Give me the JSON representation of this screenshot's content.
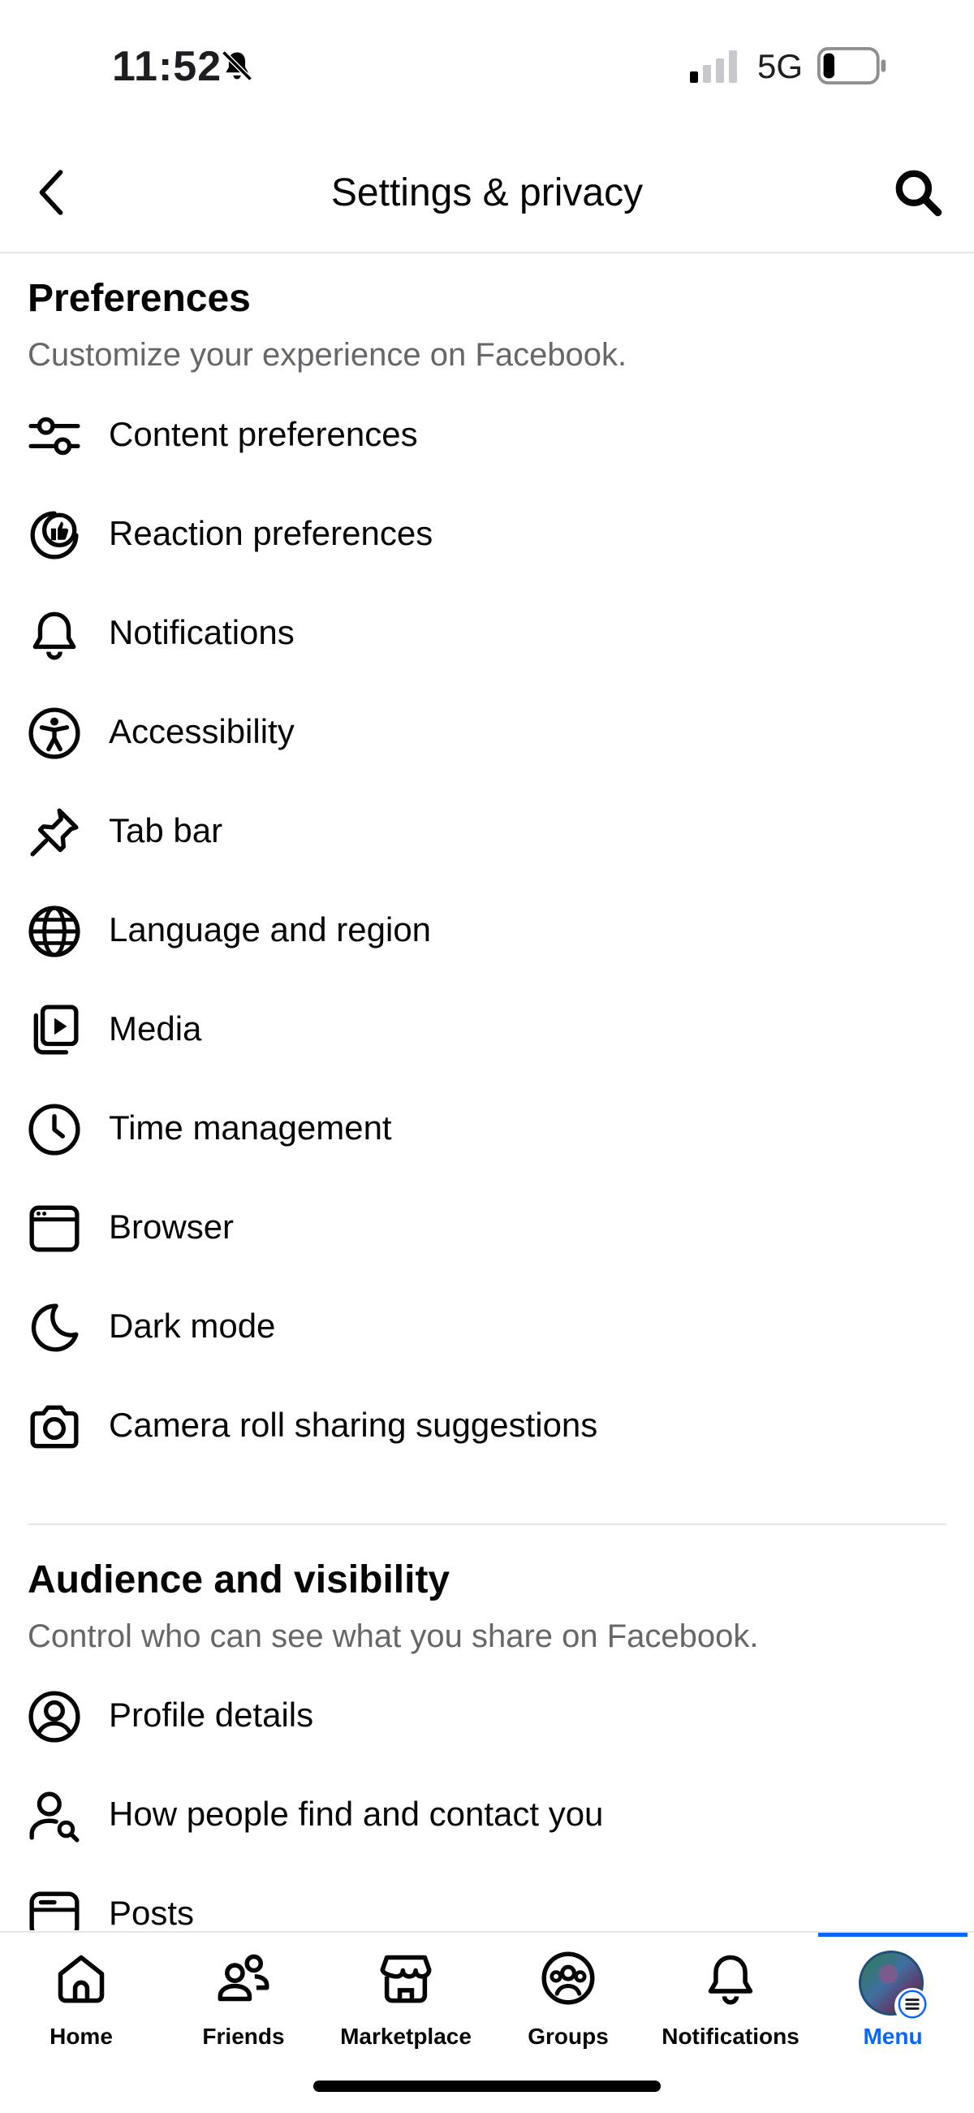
{
  "status_bar": {
    "time": "11:52",
    "network": "5G"
  },
  "header": {
    "title": "Settings & privacy"
  },
  "preferences": {
    "title": "Preferences",
    "subtitle": "Customize your experience on Facebook.",
    "items": [
      {
        "label": "Content preferences",
        "icon": "sliders-icon"
      },
      {
        "label": "Reaction preferences",
        "icon": "thumbs-up-icon"
      },
      {
        "label": "Notifications",
        "icon": "bell-icon"
      },
      {
        "label": "Accessibility",
        "icon": "accessibility-icon"
      },
      {
        "label": "Tab bar",
        "icon": "pin-icon"
      },
      {
        "label": "Language and region",
        "icon": "globe-icon"
      },
      {
        "label": "Media",
        "icon": "media-icon"
      },
      {
        "label": "Time management",
        "icon": "clock-icon"
      },
      {
        "label": "Browser",
        "icon": "browser-icon"
      },
      {
        "label": "Dark mode",
        "icon": "moon-icon"
      },
      {
        "label": "Camera roll sharing suggestions",
        "icon": "camera-icon"
      }
    ]
  },
  "audience": {
    "title": "Audience and visibility",
    "subtitle": "Control who can see what you share on Facebook.",
    "items": [
      {
        "label": "Profile details",
        "icon": "user-circle-icon"
      },
      {
        "label": "How people find and contact you",
        "icon": "user-search-icon"
      },
      {
        "label": "Posts",
        "icon": "posts-icon"
      }
    ]
  },
  "bottom_nav": {
    "tabs": [
      {
        "label": "Home",
        "icon": "home-icon"
      },
      {
        "label": "Friends",
        "icon": "friends-icon"
      },
      {
        "label": "Marketplace",
        "icon": "marketplace-icon"
      },
      {
        "label": "Groups",
        "icon": "groups-icon"
      },
      {
        "label": "Notifications",
        "icon": "bell-icon"
      },
      {
        "label": "Menu",
        "icon": "avatar"
      }
    ],
    "active_tab": "Menu"
  },
  "colors": {
    "accent": "#0866ff",
    "text": "#050505",
    "secondary_text": "#65676b",
    "divider": "#e4e6eb"
  }
}
